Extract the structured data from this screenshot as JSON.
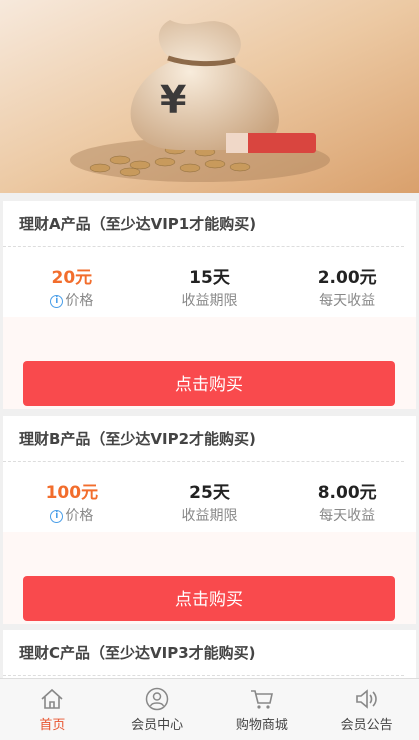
{
  "products": [
    {
      "title": "理财A产品（至少达VIP1才能购买)",
      "price": "20元",
      "price_label": "价格",
      "period": "15天",
      "period_label": "收益期限",
      "daily": "2.00元",
      "daily_label": "每天收益",
      "button": "点击购买"
    },
    {
      "title": "理财B产品（至少达VIP2才能购买)",
      "price": "100元",
      "price_label": "价格",
      "period": "25天",
      "period_label": "收益期限",
      "daily": "8.00元",
      "daily_label": "每天收益",
      "button": "点击购买"
    },
    {
      "title": "理财C产品（至少达VIP3才能购买)"
    }
  ],
  "banner": {
    "symbol": "¥"
  },
  "tabbar": [
    {
      "label": "首页",
      "icon": "home-icon",
      "active": true
    },
    {
      "label": "会员中心",
      "icon": "user-icon"
    },
    {
      "label": "购物商城",
      "icon": "cart-icon"
    },
    {
      "label": "会员公告",
      "icon": "speaker-icon"
    }
  ],
  "colors": {
    "accent": "#f94a4d",
    "price": "#f26d2c",
    "active_tab": "#e8542f"
  }
}
